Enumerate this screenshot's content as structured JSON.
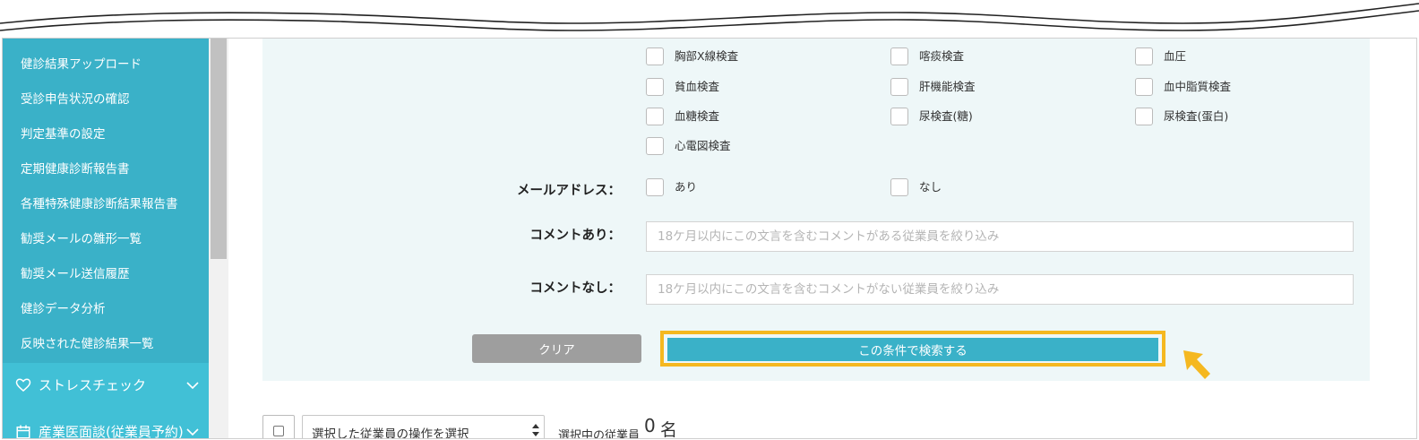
{
  "sidebar": {
    "items": [
      {
        "label": "健診結果アップロード"
      },
      {
        "label": "受診申告状況の確認"
      },
      {
        "label": "判定基準の設定"
      },
      {
        "label": "定期健康診断報告書"
      },
      {
        "label": "各種特殊健康診断結果報告書"
      },
      {
        "label": "勧奨メールの雛形一覧"
      },
      {
        "label": "勧奨メール送信履歴"
      },
      {
        "label": "健診データ分析"
      },
      {
        "label": "反映された健診結果一覧"
      }
    ],
    "sections": [
      {
        "label": "ストレスチェック",
        "icon": "heart-icon"
      },
      {
        "label": "産業医面談(従業員予約)",
        "icon": "calendar-icon"
      }
    ]
  },
  "exam_checkboxes": [
    {
      "label": "胸部X線検査"
    },
    {
      "label": "喀痰検査"
    },
    {
      "label": "血圧"
    },
    {
      "label": "貧血検査"
    },
    {
      "label": "肝機能検査"
    },
    {
      "label": "血中脂質検査"
    },
    {
      "label": "血糖検査"
    },
    {
      "label": "尿検査(糖)"
    },
    {
      "label": "尿検査(蛋白)"
    },
    {
      "label": "心電図検査"
    }
  ],
  "email_filter": {
    "label": "メールアドレス：",
    "options": [
      {
        "label": "あり"
      },
      {
        "label": "なし"
      }
    ]
  },
  "comment_with": {
    "label": "コメントあり：",
    "placeholder": "18ケ月以内にこの文言を含むコメントがある従業員を絞り込み"
  },
  "comment_without": {
    "label": "コメントなし：",
    "placeholder": "18ケ月以内にこの文言を含むコメントがない従業員を絞り込み"
  },
  "buttons": {
    "clear": "クリア",
    "search": "この条件で検索する"
  },
  "bulk_action": {
    "select_value": "選択した従業員の操作を選択",
    "selected_label": "選択中の従業員",
    "selected_count": "0",
    "selected_unit": "名"
  },
  "colors": {
    "sidebar": "#3ab1c8",
    "sidebar_section": "#41c0d6",
    "panel": "#eef7f8",
    "primary": "#3ab1c8",
    "highlight": "#f5b820",
    "clear_button": "#9e9e9e"
  }
}
